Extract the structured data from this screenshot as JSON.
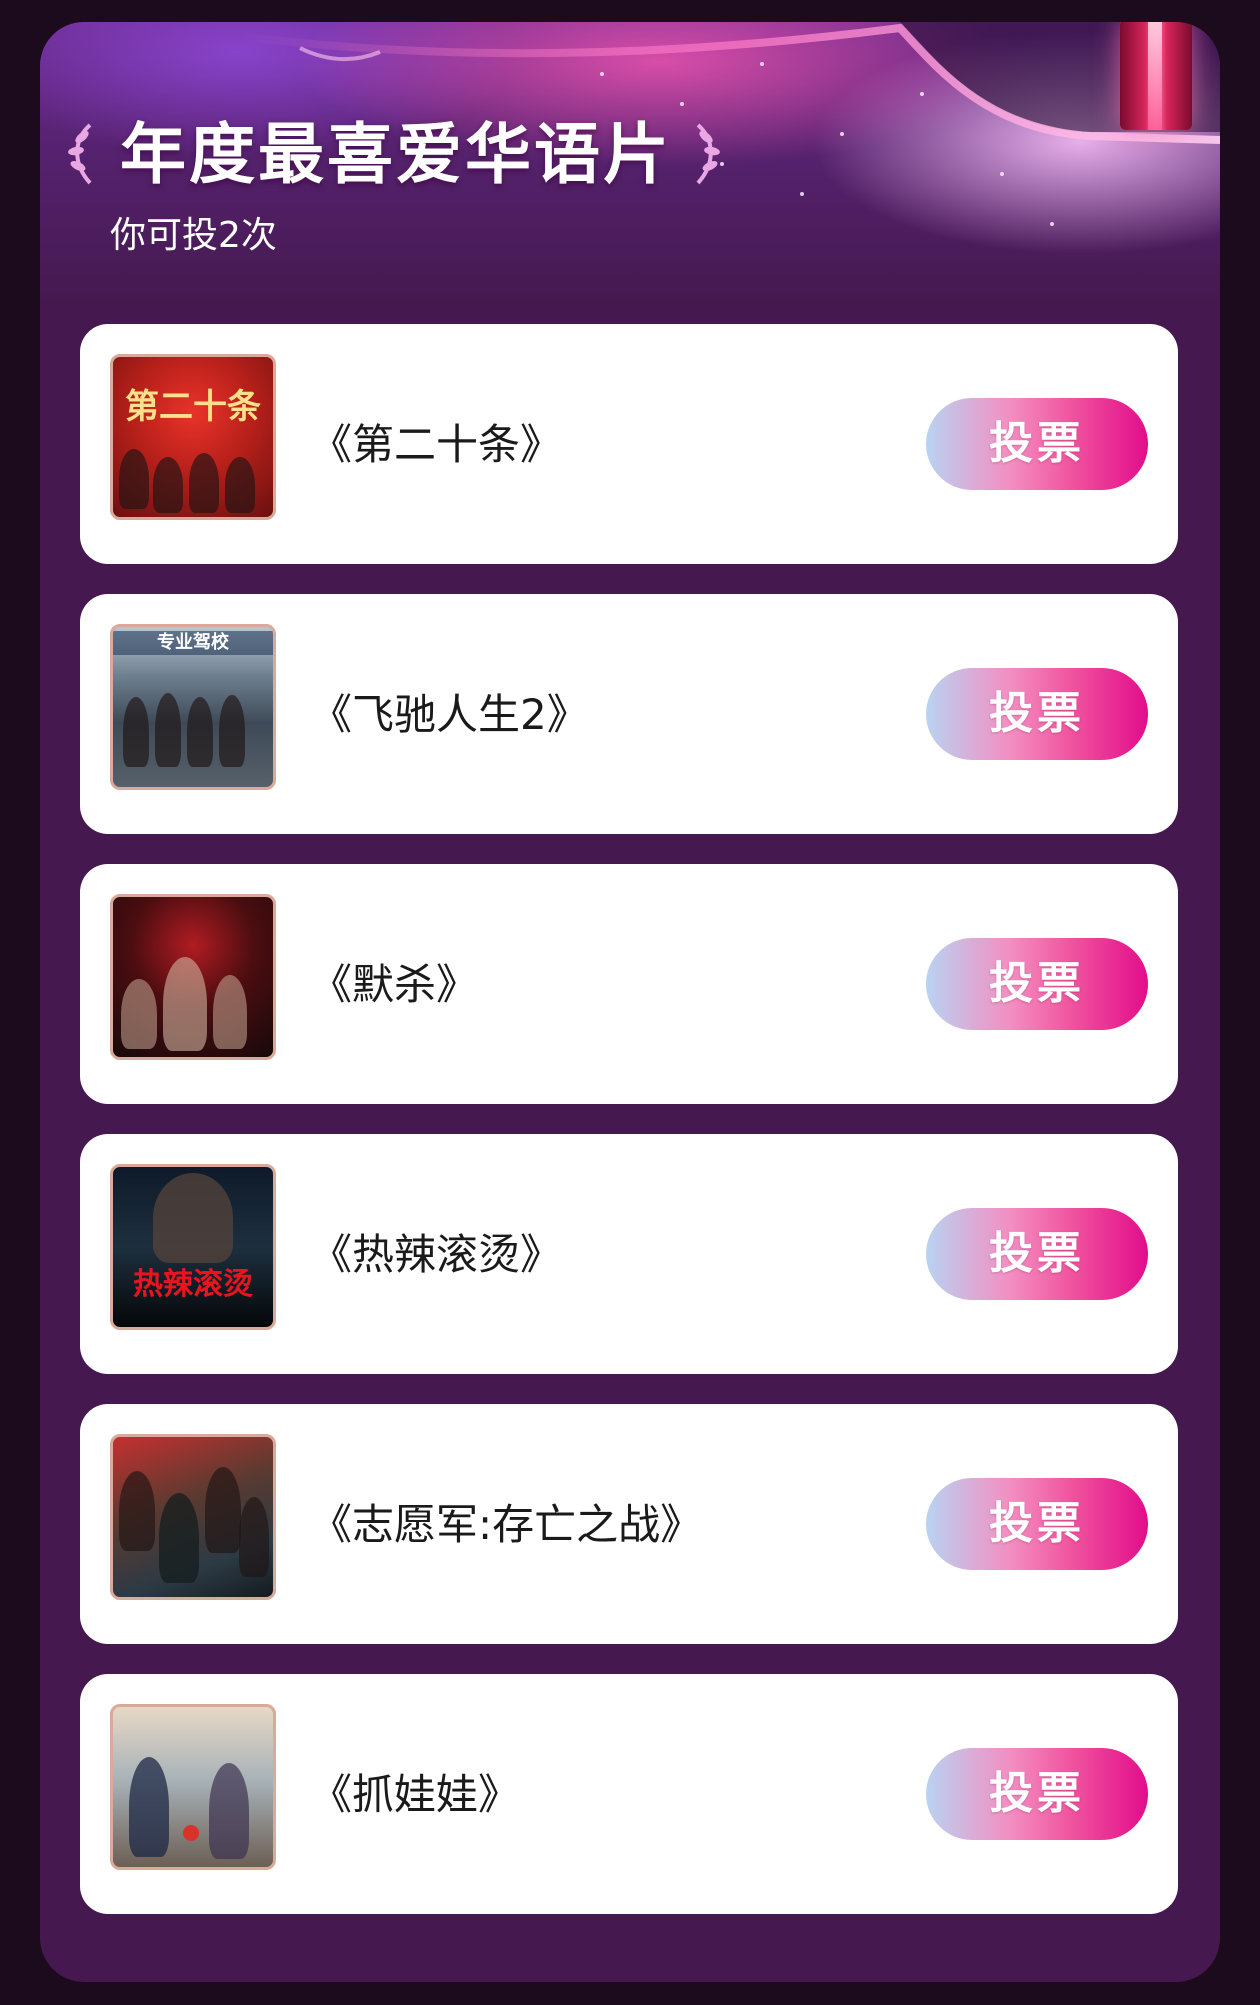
{
  "header": {
    "title": "年度最喜爱华语片",
    "vote_limit": "你可投2次"
  },
  "movies": [
    {
      "title": "《第二十条》",
      "vote_label": "投票",
      "poster_text": "第二十条",
      "poster_theme": "red"
    },
    {
      "title": "《飞驰人生2》",
      "vote_label": "投票",
      "poster_text": "专业驾校",
      "poster_theme": "gray"
    },
    {
      "title": "《默杀》",
      "vote_label": "投票",
      "poster_text": "",
      "poster_theme": "dark-red"
    },
    {
      "title": "《热辣滚烫》",
      "vote_label": "投票",
      "poster_text": "热辣滚烫",
      "poster_theme": "night"
    },
    {
      "title": "《志愿军:存亡之战》",
      "vote_label": "投票",
      "poster_text": "",
      "poster_theme": "battle"
    },
    {
      "title": "《抓娃娃》",
      "vote_label": "投票",
      "poster_text": "",
      "poster_theme": "street"
    }
  ],
  "colors": {
    "background": "#1c0a1d",
    "panel": "#45194f",
    "card": "#ffffff",
    "button_gradient_start": "#b9d3f2",
    "button_gradient_end": "#e20d8b"
  }
}
